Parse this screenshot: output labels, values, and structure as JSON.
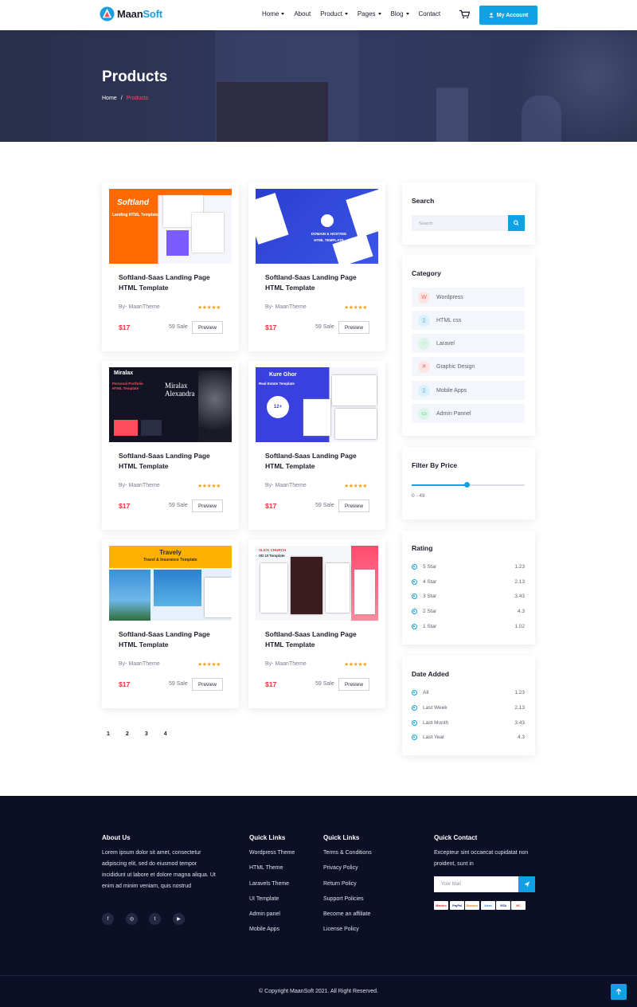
{
  "brand": {
    "name_a": "Maan",
    "name_b": "Soft",
    "accent": "#0fa0e6"
  },
  "nav": {
    "items": [
      {
        "label": "Home",
        "dropdown": true
      },
      {
        "label": "About",
        "dropdown": false
      },
      {
        "label": "Product",
        "dropdown": true
      },
      {
        "label": "Pages",
        "dropdown": true
      },
      {
        "label": "Blog",
        "dropdown": true
      },
      {
        "label": "Contact",
        "dropdown": false
      }
    ],
    "account_label": "My Account",
    "cart_icon": "cart-icon"
  },
  "hero": {
    "title": "Products",
    "breadcrumb_home": "Home",
    "breadcrumb_sep": "/",
    "breadcrumb_current": "Products"
  },
  "products": [
    {
      "title": "Softland-Saas Landing Page HTML Template",
      "by": "By- MaanTheme",
      "stars": "★★★★★",
      "price": "$17",
      "sale": "59 Sale",
      "button": "Preview",
      "thumb_text": "Softland",
      "thumb_sub": "Landing HTML Template"
    },
    {
      "title": "Softland-Saas Landing Page HTML Template",
      "by": "By- MaanTheme",
      "stars": "★★★★★",
      "price": "$17",
      "sale": "59 Sale",
      "button": "Preview",
      "thumb_text": "DOMAIN & HOSTING",
      "thumb_sub": "HTML TEMPLATE"
    },
    {
      "title": "Softland-Saas Landing Page HTML Template",
      "by": "By- MaanTheme",
      "stars": "★★★★★",
      "price": "$17",
      "sale": "59 Sale",
      "button": "Preview",
      "thumb_text": "Miralax",
      "thumb_sub": "Personal Portfolio HTML Template"
    },
    {
      "title": "Softland-Saas Landing Page HTML Template",
      "by": "By- MaanTheme",
      "stars": "★★★★★",
      "price": "$17",
      "sale": "59 Sale",
      "button": "Preview",
      "thumb_text": "Kure Ghor",
      "thumb_sub": "Real Estate Template"
    },
    {
      "title": "Softland-Saas Landing Page HTML Template",
      "by": "By- MaanTheme",
      "stars": "★★★★★",
      "price": "$17",
      "sale": "59 Sale",
      "button": "Preview",
      "thumb_text": "Travely",
      "thumb_sub": "Travel & Insurance Template"
    },
    {
      "title": "Softland-Saas Landing Page HTML Template",
      "by": "By- MaanTheme",
      "stars": "★★★★★",
      "price": "$17",
      "sale": "59 Sale",
      "button": "Preview",
      "thumb_text": "SLICK CHURCH",
      "thumb_sub": "XD UI Template"
    }
  ],
  "pagination": [
    "1",
    "2",
    "3",
    "4"
  ],
  "sidebar": {
    "search": {
      "title": "Search",
      "placeholder": "Search"
    },
    "category": {
      "title": "Category",
      "items": [
        {
          "label": "Wordpress",
          "icon": "wordpress-icon",
          "color": "#ff5b5b",
          "bg": "#ffe4e4"
        },
        {
          "label": "HTML css",
          "icon": "html-icon",
          "color": "#2aa7e6",
          "bg": "#dcf0fb"
        },
        {
          "label": "Laravel",
          "icon": "laravel-icon",
          "color": "#2fbf71",
          "bg": "#ddf5e8"
        },
        {
          "label": "Graphic Design",
          "icon": "design-icon",
          "color": "#ff5b5b",
          "bg": "#ffe4e4"
        },
        {
          "label": "Mobile Apps",
          "icon": "mobile-icon",
          "color": "#2aa7e6",
          "bg": "#dcf0fb"
        },
        {
          "label": "Admin Pannel",
          "icon": "admin-icon",
          "color": "#2fbf71",
          "bg": "#ddf5e8"
        }
      ]
    },
    "price": {
      "title": "Filter By Price",
      "range": "0 - 49",
      "value_fraction": 0.49
    },
    "rating": {
      "title": "Rating",
      "items": [
        {
          "label": "5 Star",
          "count": "1.23"
        },
        {
          "label": "4 Star",
          "count": "2.13"
        },
        {
          "label": "3 Star",
          "count": "3.43"
        },
        {
          "label": "2 Star",
          "count": "4.3"
        },
        {
          "label": "1 Star",
          "count": "1.02"
        }
      ]
    },
    "date": {
      "title": "Date Added",
      "items": [
        {
          "label": "All",
          "count": "1.23"
        },
        {
          "label": "Last Week",
          "count": "2.13"
        },
        {
          "label": "Last Month",
          "count": "3.43"
        },
        {
          "label": "Last Year",
          "count": "4.3"
        }
      ]
    }
  },
  "footer": {
    "about": {
      "title": "About Us",
      "text": "Lorem ipsum dolor sit amet, consectetur adipiscing elit, sed do eiusmod tempor incididunt ut labore et dolore magna aliqua. Ut enim ad minim veniam, quis nostrud",
      "social": [
        "f",
        "◎",
        "t",
        "▶"
      ]
    },
    "links1": {
      "title": "Quick Links",
      "items": [
        "Wordpress Theme",
        "HTML Theme",
        "Laravels Theme",
        "UI Template",
        "Admin panel",
        "Mobile Apps"
      ]
    },
    "links2": {
      "title": "Quick Links",
      "items": [
        "Terms & Conditions",
        "Privacy Policy",
        "Return Policy",
        "Support Policies",
        "Become an affiliate",
        "License Policy"
      ]
    },
    "contact": {
      "title": "Quick Contact",
      "text": "Excepteur sint occaecat cupidatat non proident, sunt in",
      "placeholder": "Your Mail",
      "payments": [
        "Maestro",
        "PayPal",
        "Discover",
        "Amex",
        "VISA",
        "MC"
      ]
    },
    "copyright": "© Copyright MaanSoft 2021. All Right Reserved."
  }
}
